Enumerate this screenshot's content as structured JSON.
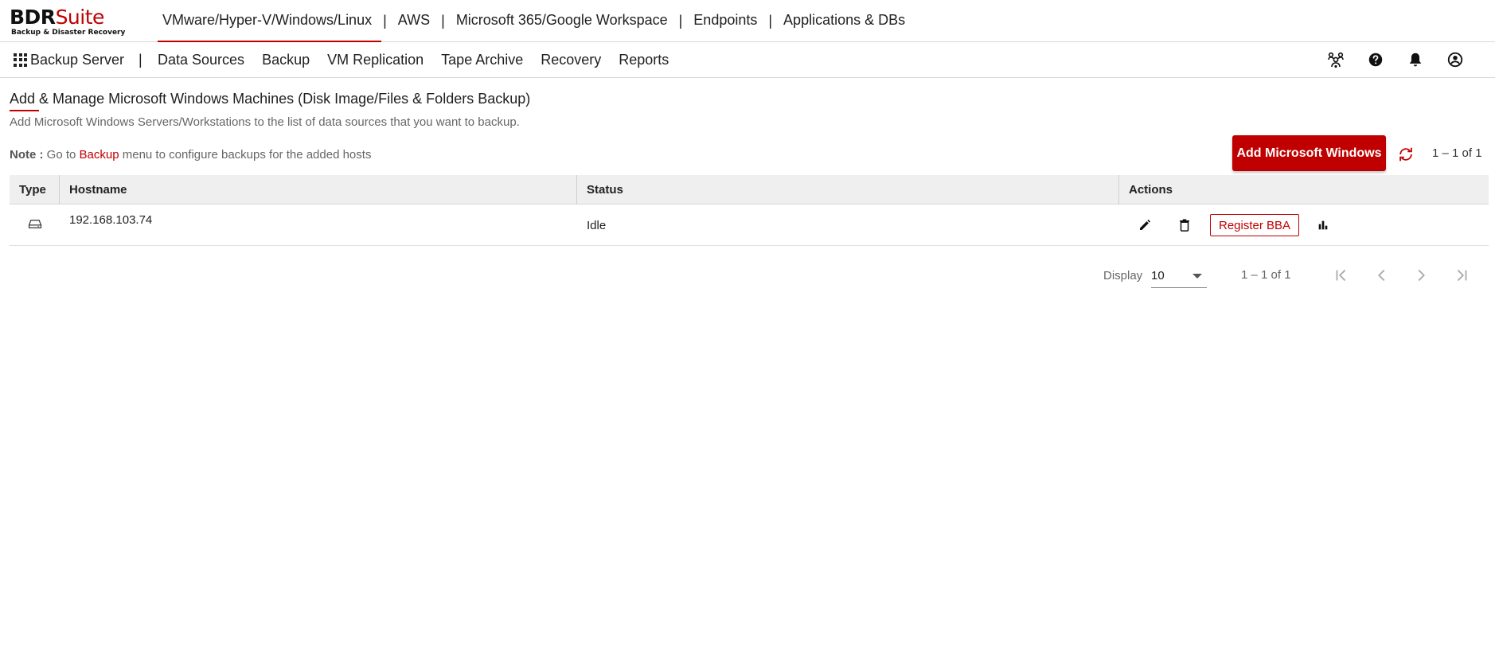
{
  "brand": {
    "name_dark": "BDR",
    "name_accent": "Suite",
    "tagline": "Backup & Disaster Recovery",
    "accent_color": "#c00000"
  },
  "product_nav": {
    "tabs": [
      {
        "label": "VMware/Hyper-V/Windows/Linux",
        "active": true
      },
      {
        "label": "AWS"
      },
      {
        "label": "Microsoft 365/Google Workspace"
      },
      {
        "label": "Endpoints"
      },
      {
        "label": "Applications & DBs"
      }
    ],
    "separator": "|"
  },
  "sub_nav": {
    "apps_label": "Backup Server",
    "separator": "|",
    "items": [
      "Data Sources",
      "Backup",
      "VM Replication",
      "Tape Archive",
      "Recovery",
      "Reports"
    ],
    "icons": [
      "community-icon",
      "help-icon",
      "notifications-icon",
      "account-icon"
    ]
  },
  "page": {
    "title": "Add & Manage Microsoft Windows Machines (Disk Image/Files & Folders Backup)",
    "subtitle": "Add Microsoft Windows Servers/Workstations to the list of data sources that you want to backup.",
    "note_label": "Note :",
    "note_prefix": " Go to ",
    "note_link": "Backup",
    "note_suffix": " menu to configure backups for the added hosts",
    "add_button": "Add Microsoft Windows",
    "top_range": "1 – 1 of 1"
  },
  "table": {
    "columns": [
      "Type",
      "Hostname",
      "Status",
      "Actions"
    ],
    "rows": [
      {
        "type_icon": "hard-drive-icon",
        "hostname": "192.168.103.74",
        "status": "Idle",
        "register_label": "Register BBA"
      }
    ]
  },
  "pagination": {
    "display_label": "Display",
    "page_size": "10",
    "range": "1 – 1 of 1"
  }
}
